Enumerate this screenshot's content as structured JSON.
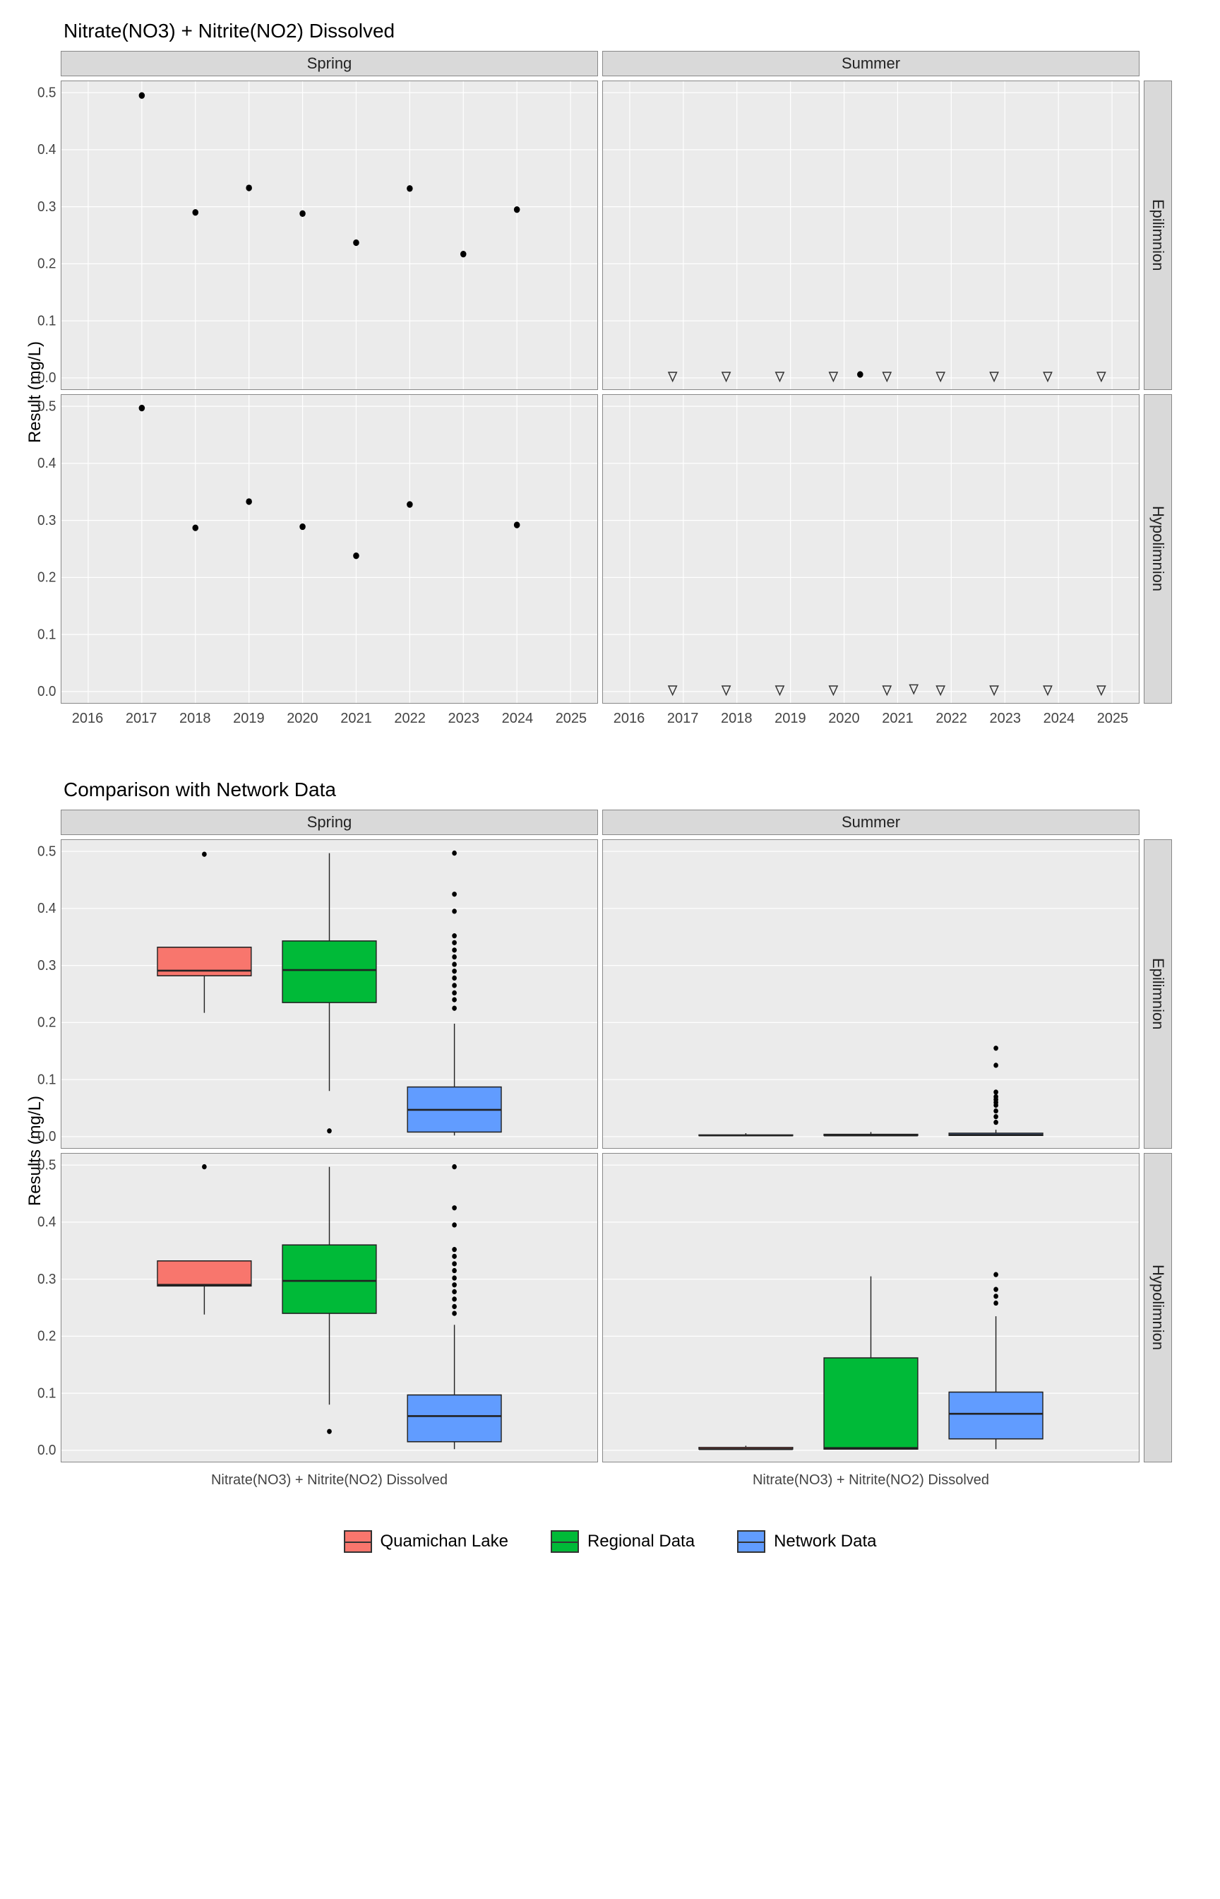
{
  "chart_data": [
    {
      "type": "scatter",
      "title": "Nitrate(NO3) + Nitrite(NO2) Dissolved",
      "xlabel": "",
      "ylabel": "Result (mg/L)",
      "x_ticks": [
        2016,
        2017,
        2018,
        2019,
        2020,
        2021,
        2022,
        2023,
        2024,
        2025
      ],
      "ylim": [
        0,
        0.5
      ],
      "y_ticks": [
        0.0,
        0.1,
        0.2,
        0.3,
        0.4,
        0.5
      ],
      "facets": {
        "cols": [
          "Spring",
          "Summer"
        ],
        "rows": [
          "Epilimnion",
          "Hypolimnion"
        ]
      },
      "panels": {
        "Spring_Epilimnion": {
          "x": [
            2017,
            2018,
            2019,
            2020,
            2021,
            2022,
            2023,
            2024
          ],
          "y": [
            0.495,
            0.29,
            0.333,
            0.288,
            0.237,
            0.332,
            0.217,
            0.295
          ],
          "censored": [
            false,
            false,
            false,
            false,
            false,
            false,
            false,
            false
          ]
        },
        "Spring_Hypolimnion": {
          "x": [
            2017,
            2018,
            2019,
            2020,
            2021,
            2022,
            2024
          ],
          "y": [
            0.497,
            0.287,
            0.333,
            0.289,
            0.238,
            0.328,
            0.292
          ],
          "censored": [
            false,
            false,
            false,
            false,
            false,
            false,
            false
          ]
        },
        "Summer_Epilimnion": {
          "x": [
            2016.8,
            2017.8,
            2018.8,
            2019.8,
            2020.3,
            2020.8,
            2021.8,
            2022.8,
            2023.8,
            2024.8
          ],
          "y": [
            0.002,
            0.002,
            0.002,
            0.002,
            0.006,
            0.002,
            0.002,
            0.002,
            0.002,
            0.002
          ],
          "censored": [
            true,
            true,
            true,
            true,
            false,
            true,
            true,
            true,
            true,
            true
          ]
        },
        "Summer_Hypolimnion": {
          "x": [
            2016.8,
            2017.8,
            2018.8,
            2019.8,
            2020.8,
            2021.3,
            2021.8,
            2022.8,
            2023.8,
            2024.8
          ],
          "y": [
            0.002,
            0.002,
            0.002,
            0.002,
            0.002,
            0.004,
            0.002,
            0.002,
            0.002,
            0.002
          ],
          "censored": [
            true,
            true,
            true,
            true,
            true,
            true,
            true,
            true,
            true,
            true
          ]
        }
      }
    },
    {
      "type": "boxplot",
      "title": "Comparison with Network Data",
      "xlabel": "Nitrate(NO3) + Nitrite(NO2) Dissolved",
      "ylabel": "Results (mg/L)",
      "ylim": [
        0,
        0.5
      ],
      "y_ticks": [
        0.0,
        0.1,
        0.2,
        0.3,
        0.4,
        0.5
      ],
      "facets": {
        "cols": [
          "Spring",
          "Summer"
        ],
        "rows": [
          "Epilimnion",
          "Hypolimnion"
        ]
      },
      "legend": [
        {
          "name": "Quamichan Lake",
          "color": "#f8766d"
        },
        {
          "name": "Regional Data",
          "color": "#00ba38"
        },
        {
          "name": "Network Data",
          "color": "#619cff"
        }
      ],
      "panels": {
        "Spring_Epilimnion": {
          "boxes": [
            {
              "series": "Quamichan Lake",
              "min": 0.217,
              "q1": 0.282,
              "median": 0.291,
              "q3": 0.332,
              "max": 0.333,
              "outliers": [
                0.495
              ]
            },
            {
              "series": "Regional Data",
              "min": 0.08,
              "q1": 0.235,
              "median": 0.292,
              "q3": 0.343,
              "max": 0.497,
              "outliers": [
                0.01
              ]
            },
            {
              "series": "Network Data",
              "min": 0.002,
              "q1": 0.008,
              "median": 0.047,
              "q3": 0.087,
              "max": 0.198,
              "outliers": [
                0.225,
                0.24,
                0.252,
                0.265,
                0.278,
                0.29,
                0.302,
                0.315,
                0.327,
                0.34,
                0.352,
                0.395,
                0.425,
                0.497
              ]
            }
          ]
        },
        "Spring_Hypolimnion": {
          "boxes": [
            {
              "series": "Quamichan Lake",
              "min": 0.238,
              "q1": 0.288,
              "median": 0.29,
              "q3": 0.332,
              "max": 0.333,
              "outliers": [
                0.497
              ]
            },
            {
              "series": "Regional Data",
              "min": 0.08,
              "q1": 0.24,
              "median": 0.297,
              "q3": 0.36,
              "max": 0.497,
              "outliers": [
                0.033
              ]
            },
            {
              "series": "Network Data",
              "min": 0.002,
              "q1": 0.015,
              "median": 0.06,
              "q3": 0.097,
              "max": 0.22,
              "outliers": [
                0.24,
                0.252,
                0.265,
                0.278,
                0.29,
                0.302,
                0.315,
                0.327,
                0.34,
                0.352,
                0.395,
                0.425,
                0.497
              ]
            }
          ]
        },
        "Summer_Epilimnion": {
          "boxes": [
            {
              "series": "Quamichan Lake",
              "min": 0.002,
              "q1": 0.002,
              "median": 0.002,
              "q3": 0.003,
              "max": 0.006,
              "outliers": []
            },
            {
              "series": "Regional Data",
              "min": 0.002,
              "q1": 0.002,
              "median": 0.002,
              "q3": 0.004,
              "max": 0.008,
              "outliers": []
            },
            {
              "series": "Network Data",
              "min": 0.002,
              "q1": 0.002,
              "median": 0.003,
              "q3": 0.006,
              "max": 0.012,
              "outliers": [
                0.025,
                0.035,
                0.045,
                0.055,
                0.06,
                0.065,
                0.07,
                0.078,
                0.125,
                0.155
              ]
            }
          ]
        },
        "Summer_Hypolimnion": {
          "boxes": [
            {
              "series": "Quamichan Lake",
              "min": 0.002,
              "q1": 0.002,
              "median": 0.002,
              "q3": 0.005,
              "max": 0.008,
              "outliers": []
            },
            {
              "series": "Regional Data",
              "min": 0.002,
              "q1": 0.002,
              "median": 0.004,
              "q3": 0.162,
              "max": 0.305,
              "outliers": []
            },
            {
              "series": "Network Data",
              "min": 0.002,
              "q1": 0.02,
              "median": 0.064,
              "q3": 0.102,
              "max": 0.235,
              "outliers": [
                0.258,
                0.27,
                0.282,
                0.308
              ]
            }
          ]
        }
      }
    }
  ]
}
